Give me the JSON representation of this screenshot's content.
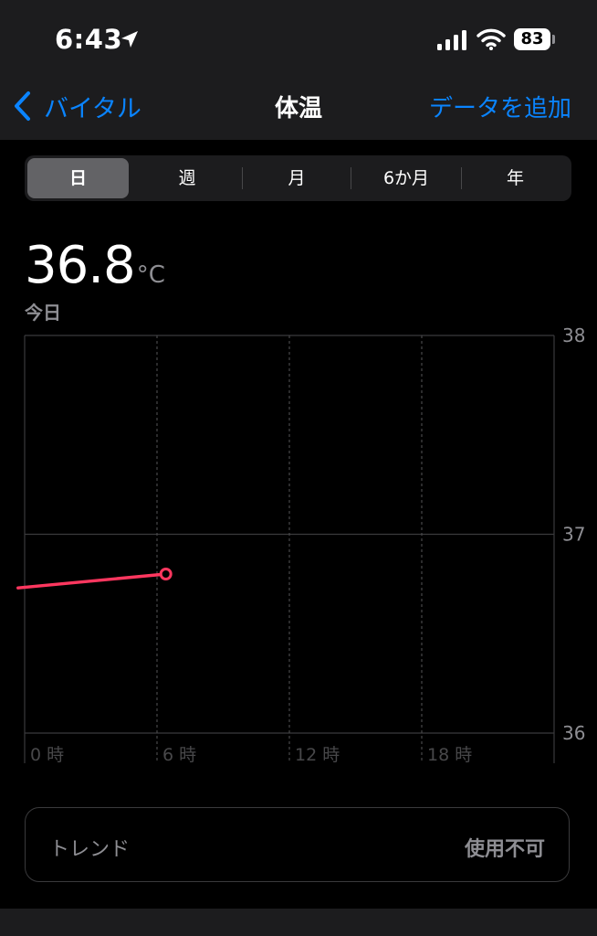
{
  "status_bar": {
    "time": "6:43",
    "battery": "83",
    "icons": [
      "location-arrow-icon",
      "cellular-signal-icon",
      "wifi-icon",
      "battery-icon"
    ]
  },
  "nav": {
    "back_label": "バイタル",
    "title": "体温",
    "add_label": "データを追加"
  },
  "segments": {
    "items": [
      {
        "label": "日",
        "selected": true
      },
      {
        "label": "週",
        "selected": false
      },
      {
        "label": "月",
        "selected": false
      },
      {
        "label": "6か月",
        "selected": false
      },
      {
        "label": "年",
        "selected": false
      }
    ]
  },
  "summary": {
    "value": "36.8",
    "unit": "°C",
    "date": "今日"
  },
  "chart_data": {
    "type": "line",
    "x_unit": "hour",
    "xlim": [
      0,
      24
    ],
    "ylim": [
      36,
      38
    ],
    "x_ticks": [
      {
        "value": 0,
        "label": "0 時"
      },
      {
        "value": 6,
        "label": "6 時"
      },
      {
        "value": 12,
        "label": "12 時"
      },
      {
        "value": 18,
        "label": "18 時"
      }
    ],
    "y_ticks": [
      {
        "value": 38,
        "label": "38"
      },
      {
        "value": 37,
        "label": "37"
      },
      {
        "value": 36,
        "label": "36"
      }
    ],
    "grid": true,
    "series": [
      {
        "color": "#ff375f",
        "points": [
          {
            "x": -0.3,
            "y": 36.73
          },
          {
            "x": 6.4,
            "y": 36.8
          }
        ],
        "last_point_marker": true
      }
    ]
  },
  "trend": {
    "label": "トレンド",
    "value": "使用不可"
  },
  "colors": {
    "accent": "#0a84ff",
    "series": "#ff375f",
    "background": "#000000",
    "panel": "#1c1c1e"
  }
}
